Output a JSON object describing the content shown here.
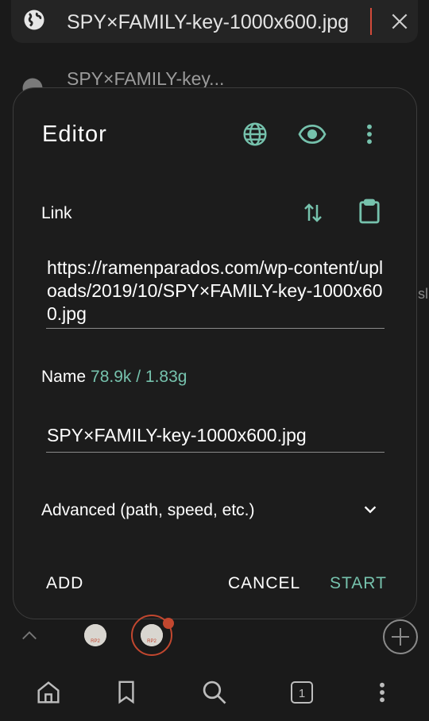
{
  "url_bar": {
    "text": "SPY×FAMILY-key-1000x600.jpg",
    "icon_left": "globe-icon",
    "icon_right": "close-icon"
  },
  "background": {
    "row_title": "SPY×FAMILY-key...",
    "side_text": "sl"
  },
  "dialog": {
    "title": "Editor",
    "header_icons": [
      "globe-icon",
      "eye-icon",
      "more-vert-icon"
    ],
    "link": {
      "label": "Link",
      "value": "https://ramenparados.com/wp-content/uploads/2019/10/SPY×FAMILY-key-1000x600.jpg",
      "icons": [
        "swap-vertical-icon",
        "clipboard-icon"
      ]
    },
    "name": {
      "label": "Name",
      "size": "78.9k / 1.83g",
      "value": "SPY×FAMILY-key-1000x600.jpg"
    },
    "advanced_label": "Advanced (path, speed, etc.)",
    "buttons": {
      "add": "ADD",
      "cancel": "CANCEL",
      "start": "START"
    }
  },
  "tabs": {
    "thumb_labels": [
      "RP2",
      "RP2"
    ]
  },
  "bottom_nav": {
    "tab_count": "1",
    "items": [
      "home-icon",
      "bookmark-icon",
      "search-icon",
      "tabs-icon",
      "more-vert-icon"
    ]
  },
  "colors": {
    "accent": "#76c2ad",
    "background": "#1a1a1a",
    "dialog": "#1c1c1c",
    "tab_highlight": "#c2472f"
  }
}
